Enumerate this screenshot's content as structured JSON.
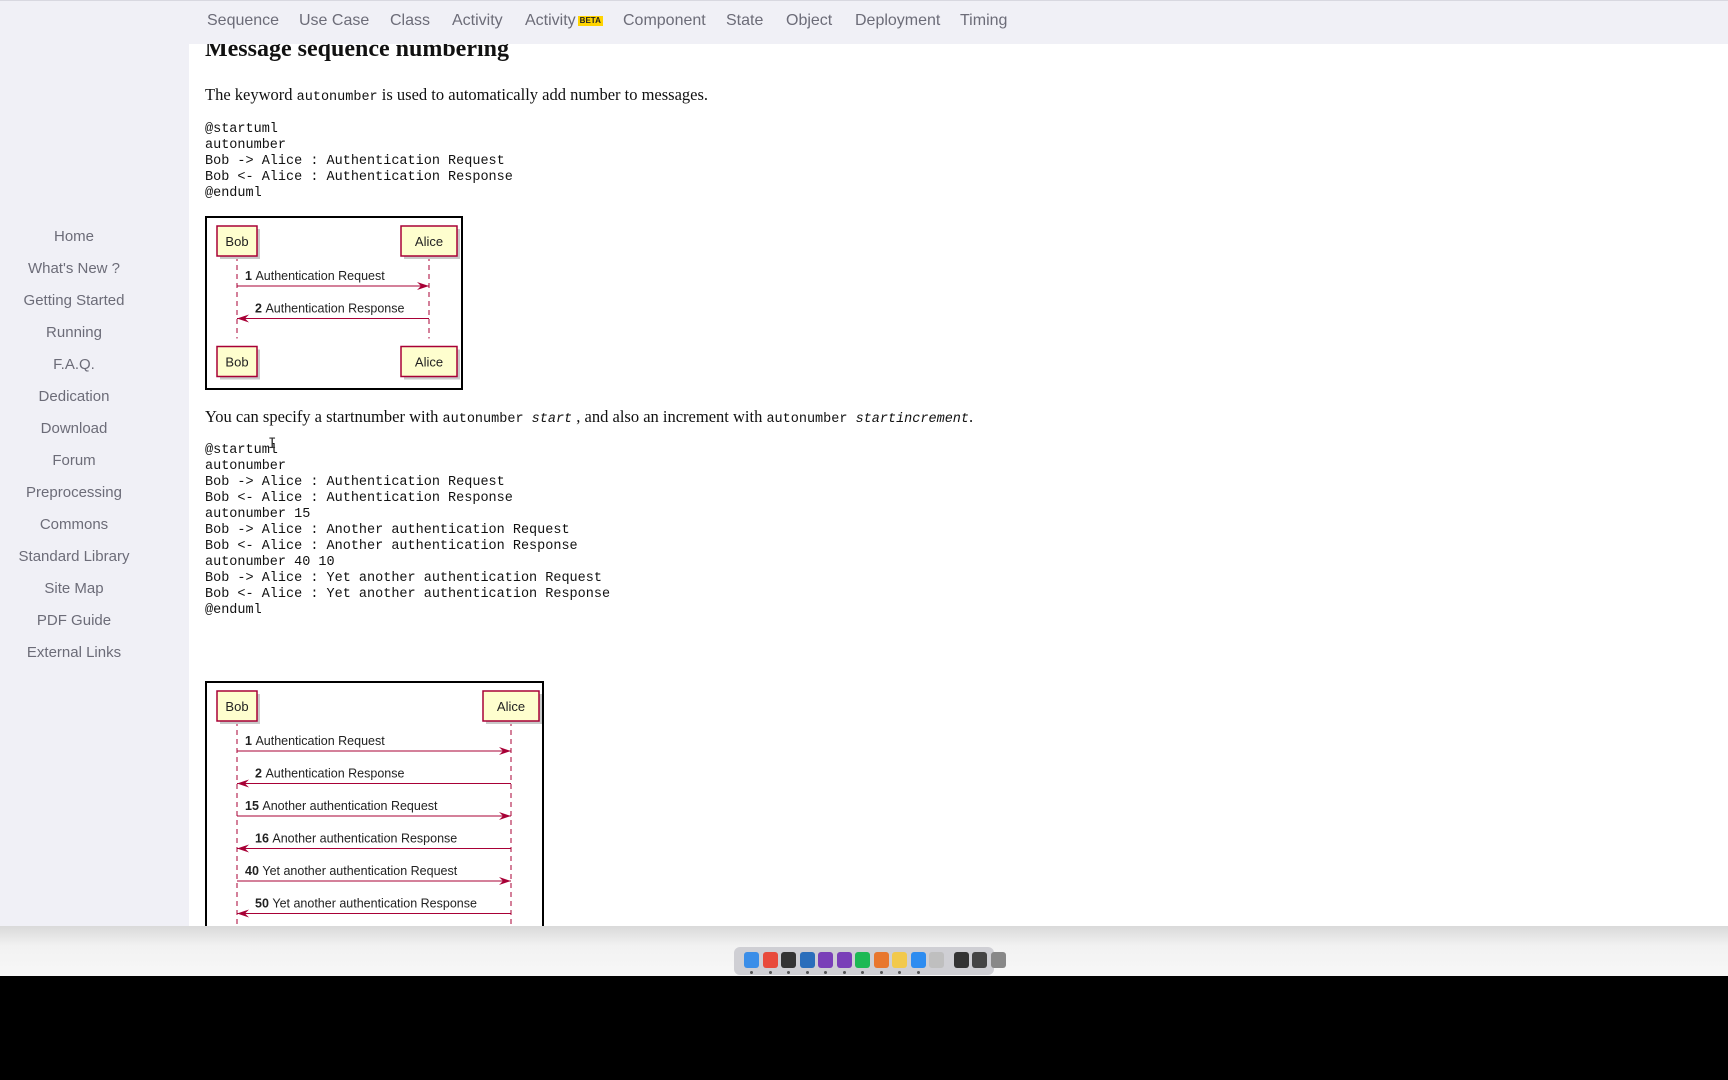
{
  "topnav": {
    "items": [
      "Sequence",
      "Use Case",
      "Class",
      "Activity",
      "Activity",
      "Component",
      "State",
      "Object",
      "Deployment",
      "Timing"
    ],
    "beta_badge": "BETA"
  },
  "sidebar": {
    "items": [
      "Home",
      "What's New ?",
      "Getting Started",
      "Running",
      "F.A.Q.",
      "Dedication",
      "Download",
      "Forum",
      "Preprocessing",
      "Commons",
      "Standard Library",
      "Site Map",
      "PDF Guide",
      "External Links"
    ]
  },
  "content": {
    "section_title": "Message sequence numbering",
    "intro": {
      "before": "The keyword ",
      "code": "autonumber",
      "after": " is used to automatically add number to messages."
    },
    "code1": [
      "@startuml",
      "autonumber",
      "Bob -> Alice : Authentication Request",
      "Bob <- Alice : Authentication Response",
      "@enduml"
    ],
    "diagram1": {
      "participants": [
        "Bob",
        "Alice"
      ],
      "messages": [
        {
          "num": "1",
          "text": "Authentication Request",
          "dir": "right"
        },
        {
          "num": "2",
          "text": "Authentication Response",
          "dir": "left"
        }
      ]
    },
    "para2": {
      "t1": "You can specify a startnumber with ",
      "c1": "autonumber ",
      "c1em": "start",
      "t2": " , and also an increment with ",
      "c2": "autonumber ",
      "c2em": "startincrement",
      "t3": "."
    },
    "code2": [
      "@startuml",
      "autonumber",
      "Bob -> Alice : Authentication Request",
      "Bob <- Alice : Authentication Response",
      "",
      "autonumber 15",
      "Bob -> Alice : Another authentication Request",
      "Bob <- Alice : Another authentication Response",
      "",
      "autonumber 40 10",
      "Bob -> Alice : Yet another authentication Request",
      "Bob <- Alice : Yet another authentication Response",
      "",
      "@enduml"
    ],
    "diagram2": {
      "participants": [
        "Bob",
        "Alice"
      ],
      "messages": [
        {
          "num": "1",
          "text": "Authentication Request",
          "dir": "right"
        },
        {
          "num": "2",
          "text": "Authentication Response",
          "dir": "left"
        },
        {
          "num": "15",
          "text": "Another authentication Request",
          "dir": "right"
        },
        {
          "num": "16",
          "text": "Another authentication Response",
          "dir": "left"
        },
        {
          "num": "40",
          "text": "Yet another authentication Request",
          "dir": "right"
        },
        {
          "num": "50",
          "text": "Yet another authentication Response",
          "dir": "left"
        }
      ]
    }
  },
  "colors": {
    "participant_fill": "#fefece",
    "participant_border": "#a80036",
    "arrow": "#a80036"
  },
  "dock": {
    "icons": [
      "finder-icon",
      "chrome-icon",
      "terminal-icon",
      "app-icon",
      "onenote-icon",
      "onenote-icon",
      "spotify-icon",
      "pen-icon",
      "notes-icon",
      "safari-icon",
      "preview-icon",
      "terminal-icon",
      "monitor-icon",
      "trash-icon"
    ]
  }
}
